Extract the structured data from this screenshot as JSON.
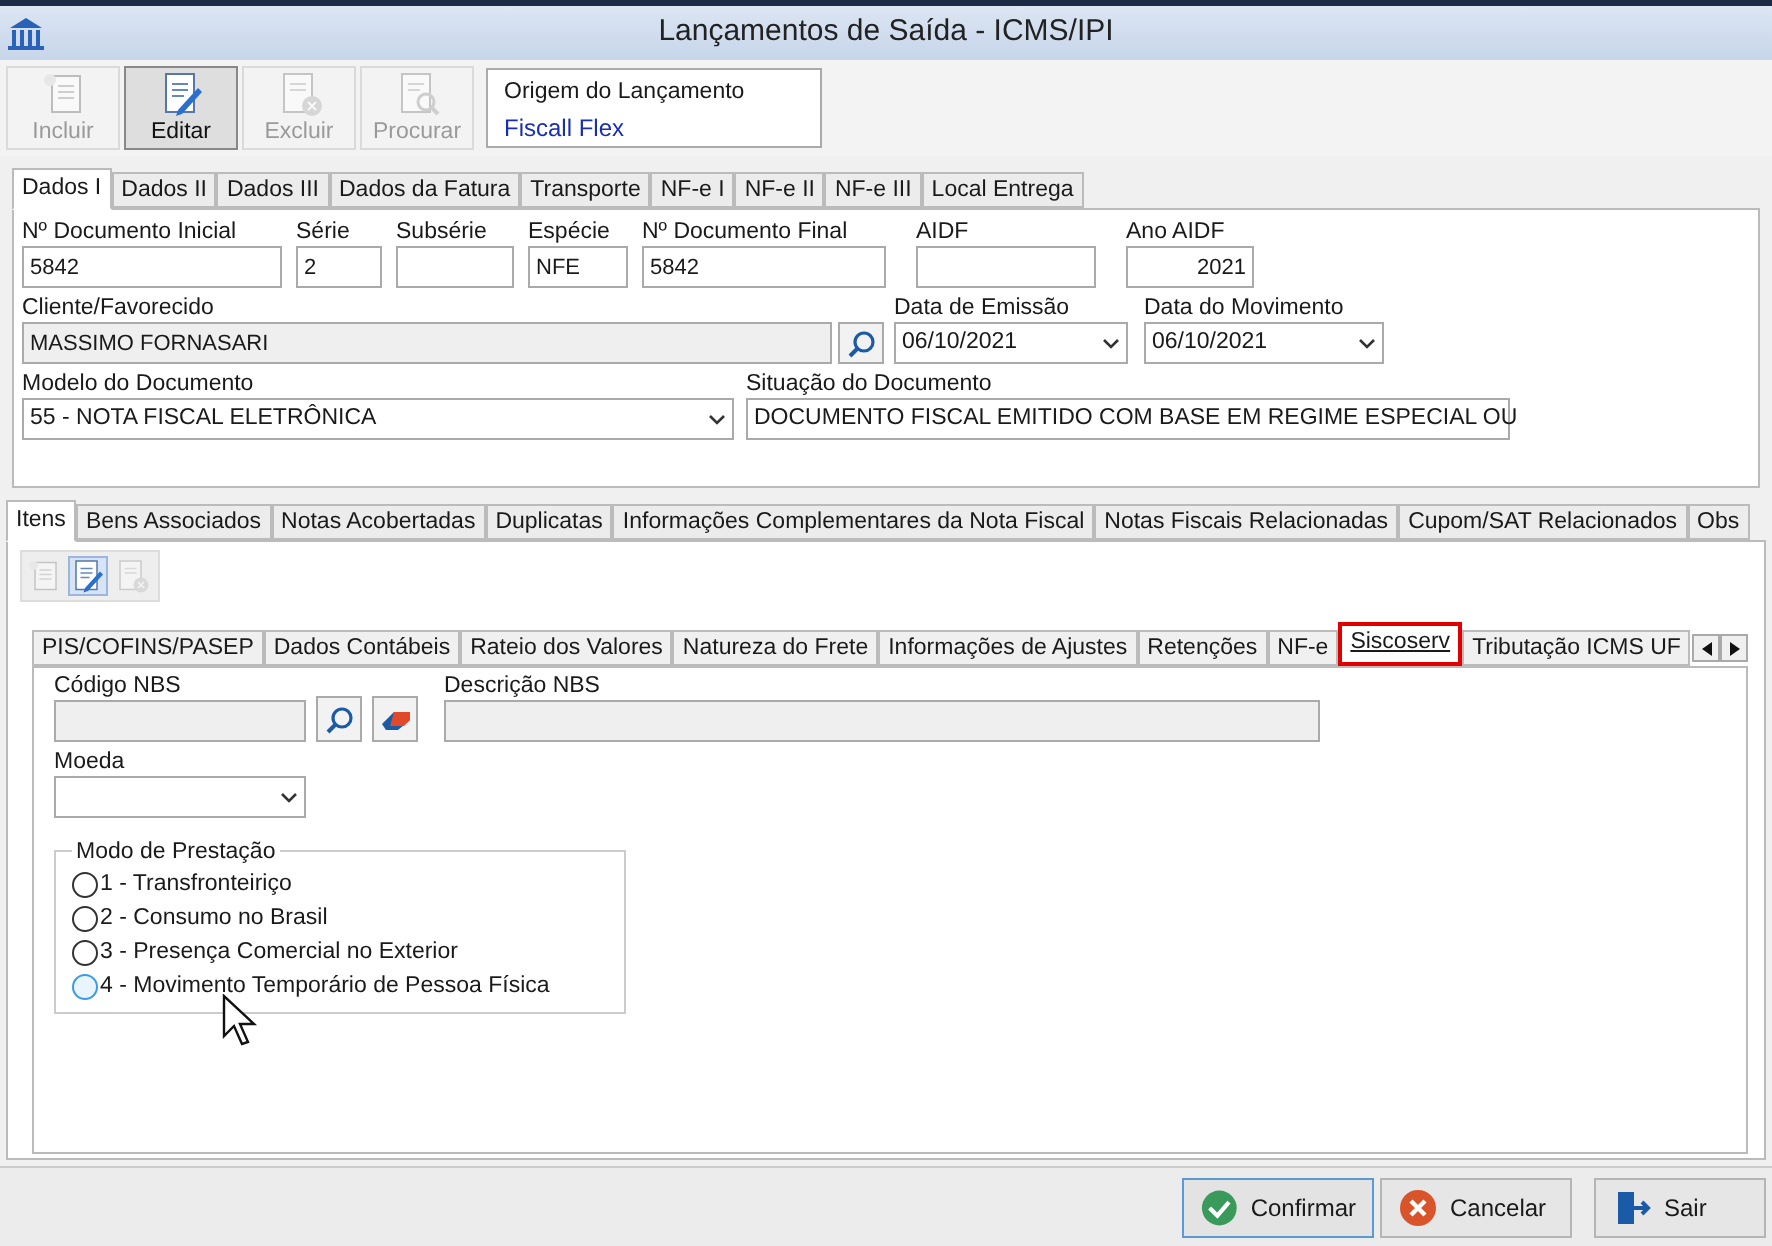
{
  "window": {
    "title": "Lançamentos de Saída - ICMS/IPI"
  },
  "toolbar": [
    {
      "kind": "new",
      "label": "Incluir",
      "disabled": true,
      "pressed": false
    },
    {
      "kind": "edit",
      "label": "Editar",
      "disabled": false,
      "pressed": true
    },
    {
      "kind": "delete",
      "label": "Excluir",
      "disabled": true,
      "pressed": false
    },
    {
      "kind": "search",
      "label": "Procurar",
      "disabled": true,
      "pressed": false
    }
  ],
  "origin": {
    "label": "Origem do Lançamento",
    "value": "Fiscall Flex"
  },
  "tabs": [
    {
      "label": "Dados I",
      "selected": true
    },
    {
      "label": "Dados II",
      "selected": false
    },
    {
      "label": "Dados III",
      "selected": false
    },
    {
      "label": "Dados da Fatura",
      "selected": false
    },
    {
      "label": "Transporte",
      "selected": false
    },
    {
      "label": "NF-e I",
      "selected": false
    },
    {
      "label": "NF-e II",
      "selected": false
    },
    {
      "label": "NF-e III",
      "selected": false
    },
    {
      "label": "Local Entrega",
      "selected": false
    }
  ],
  "row1": [
    {
      "kind": "text",
      "label": "Nº Documento Inicial",
      "value": "5842"
    },
    {
      "kind": "text",
      "label": "Série",
      "value": "2"
    },
    {
      "kind": "text",
      "label": "Subsérie"
    },
    {
      "kind": "text",
      "label": "Espécie",
      "value": "NFE"
    },
    {
      "kind": "text",
      "label": "Nº Documento Final",
      "value": "5842"
    },
    {
      "kind": "text",
      "label": "AIDF"
    },
    {
      "kind": "number",
      "label": "Ano AIDF",
      "value": "2021"
    }
  ],
  "client": {
    "label": "Cliente/Favorecido",
    "value": "MASSIMO FORNASARI"
  },
  "issue_date": {
    "label": "Data de Emissão",
    "value": "06/10/2021"
  },
  "movement_date": {
    "label": "Data do Movimento",
    "value": "06/10/2021"
  },
  "doc_model": {
    "label": "Modelo do Documento",
    "value": "55 - NOTA FISCAL ELETRÔNICA"
  },
  "doc_status": {
    "label": "Situação do Documento",
    "value": "DOCUMENTO FISCAL EMITIDO COM BASE EM REGIME ESPECIAL OU"
  },
  "lower_tabs": [
    {
      "label": "Itens",
      "selected": true
    },
    {
      "label": "Bens Associados",
      "selected": false
    },
    {
      "label": "Notas Acobertadas",
      "selected": false
    },
    {
      "label": "Duplicatas",
      "selected": false
    },
    {
      "label": "Informações Complementares da Nota Fiscal",
      "selected": false
    },
    {
      "label": "Notas Fiscais Relacionadas",
      "selected": false
    },
    {
      "label": "Cupom/SAT Relacionados",
      "selected": false
    },
    {
      "label": "Obs",
      "selected": false
    }
  ],
  "item_tabs": [
    {
      "label": "PIS/COFINS/PASEP",
      "selected": false
    },
    {
      "label": "Dados Contábeis",
      "selected": false
    },
    {
      "label": "Rateio dos Valores",
      "selected": false
    },
    {
      "label": "Natureza do Frete",
      "selected": false
    },
    {
      "label": "Informações de Ajustes",
      "selected": false
    },
    {
      "label": "Retenções",
      "selected": false
    },
    {
      "label": "NF-e",
      "selected": false
    },
    {
      "label": "Siscoserv",
      "selected": true
    },
    {
      "label": "Tributação ICMS UF",
      "selected": false
    }
  ],
  "nbs_code": {
    "label": "Código NBS"
  },
  "nbs_description": {
    "label": "Descrição NBS"
  },
  "currency": {
    "label": "Moeda"
  },
  "service_mode": {
    "label": "Modo de Prestação",
    "options": [
      {
        "label": "1 - Transfronteiriço",
        "selected": false,
        "hovered": false
      },
      {
        "label": "2 - Consumo no Brasil",
        "selected": false,
        "hovered": false
      },
      {
        "label": "3 - Presença Comercial no Exterior",
        "selected": false,
        "hovered": false
      },
      {
        "label": "4 - Movimento Temporário de Pessoa Física",
        "selected": false,
        "hovered": true
      }
    ]
  },
  "footer": [
    {
      "kind": "confirm",
      "label": "Confirmar",
      "focused": true
    },
    {
      "kind": "cancel",
      "label": "Cancelar",
      "focused": false
    },
    {
      "kind": "exit",
      "label": "Sair",
      "focused": false
    }
  ]
}
